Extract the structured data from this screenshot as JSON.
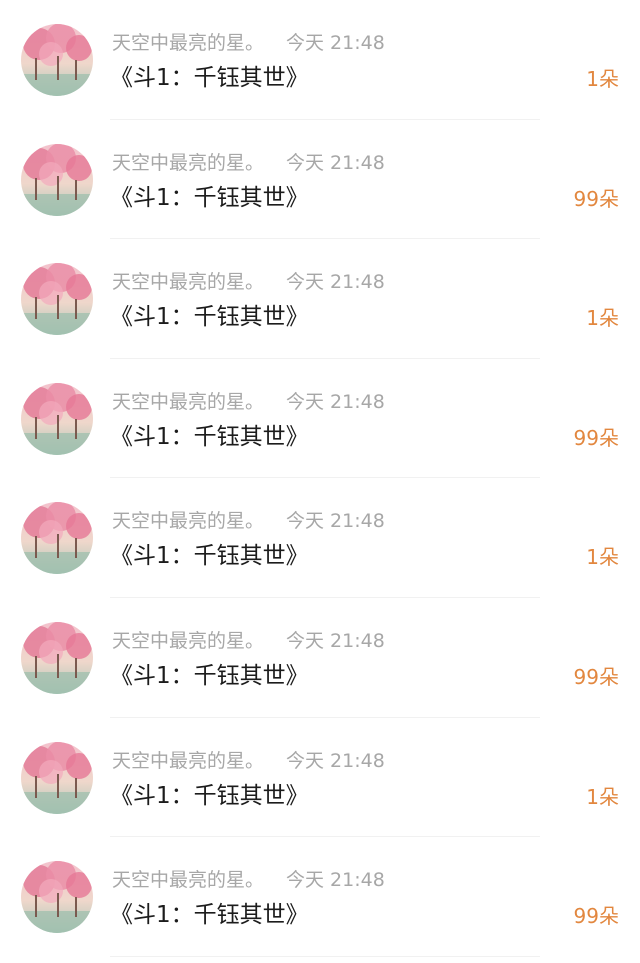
{
  "colors": {
    "name": "#a7a7a7",
    "title": "#1c1c1c",
    "gift": "#e2873f"
  },
  "gift_list": {
    "items": [
      {
        "user": "天空中最亮的星。",
        "time": "今天 21:48",
        "title": "《斗1：千钰其世》",
        "gift": "1朵"
      },
      {
        "user": "天空中最亮的星。",
        "time": "今天 21:48",
        "title": "《斗1：千钰其世》",
        "gift": "99朵"
      },
      {
        "user": "天空中最亮的星。",
        "time": "今天 21:48",
        "title": "《斗1：千钰其世》",
        "gift": "1朵"
      },
      {
        "user": "天空中最亮的星。",
        "time": "今天 21:48",
        "title": "《斗1：千钰其世》",
        "gift": "99朵"
      },
      {
        "user": "天空中最亮的星。",
        "time": "今天 21:48",
        "title": "《斗1：千钰其世》",
        "gift": "1朵"
      },
      {
        "user": "天空中最亮的星。",
        "time": "今天 21:48",
        "title": "《斗1：千钰其世》",
        "gift": "99朵"
      },
      {
        "user": "天空中最亮的星。",
        "time": "今天 21:48",
        "title": "《斗1：千钰其世》",
        "gift": "1朵"
      },
      {
        "user": "天空中最亮的星。",
        "time": "今天 21:48",
        "title": "《斗1：千钰其世》",
        "gift": "99朵"
      }
    ]
  }
}
